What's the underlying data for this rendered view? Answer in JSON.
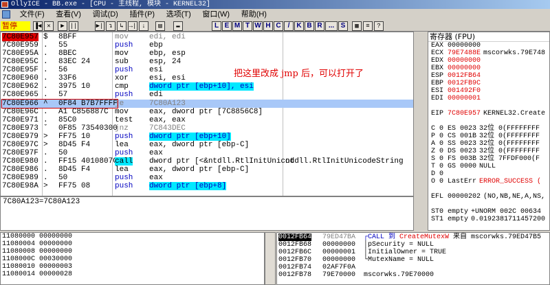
{
  "window": {
    "title": "OllyICE - BB.exe - [CPU - 主线程, 模块 - KERNEL32]"
  },
  "menu": [
    "文件(F)",
    "查看(V)",
    "调试(D)",
    "插件(P)",
    "选项(T)",
    "窗口(W)",
    "帮助(H)"
  ],
  "status": {
    "paused_label": "暂停"
  },
  "toolbar": {
    "buttons": [
      "▐◀",
      "✕",
      "▶",
      "||",
      "▶|",
      "↴",
      "↳",
      "→|",
      "↓",
      "▤",
      "▬"
    ],
    "letters": [
      "L",
      "E",
      "M",
      "T",
      "W",
      "H",
      "C",
      "/",
      "K",
      "B",
      "R",
      "...",
      "S"
    ]
  },
  "disasm": {
    "rows": [
      {
        "addr": "7C80E957",
        "mark": "$",
        "hex": "8BFF",
        "op": "mov",
        "args": "edi, edi",
        "comment": ""
      },
      {
        "addr": "7C80E959",
        "mark": ".",
        "hex": "55",
        "op": "push",
        "args": "ebp",
        "comment": ""
      },
      {
        "addr": "7C80E95A",
        "mark": ".",
        "hex": "8BEC",
        "op": "mov",
        "args": "ebp, esp",
        "comment": ""
      },
      {
        "addr": "7C80E95C",
        "mark": ".",
        "hex": "83EC 24",
        "op": "sub",
        "args": "esp, 24",
        "comment": ""
      },
      {
        "addr": "7C80E95F",
        "mark": ".",
        "hex": "56",
        "op": "push",
        "args": "esi",
        "comment": ""
      },
      {
        "addr": "7C80E960",
        "mark": ".",
        "hex": "33F6",
        "op": "xor",
        "args": "esi, esi",
        "comment": ""
      },
      {
        "addr": "7C80E962",
        "mark": ".",
        "hex": "3975 10",
        "op": "cmp",
        "args": "dword ptr [ebp+10], esi",
        "comment": ""
      },
      {
        "addr": "7C80E965",
        "mark": ".",
        "hex": "57",
        "op": "push",
        "args": "edi",
        "comment": ""
      },
      {
        "addr": "7C80E966",
        "mark": "^",
        "hex": "0F84 B7B7FFFF",
        "op": "je",
        "args": "7C80A123",
        "comment": ""
      },
      {
        "addr": "7C80E96C",
        "mark": ".",
        "hex": "A1 C856887C",
        "op": "mov",
        "args": "eax, dword ptr [7C8856C8]",
        "comment": ""
      },
      {
        "addr": "7C80E971",
        "mark": ".",
        "hex": "85C0",
        "op": "test",
        "args": "eax, eax",
        "comment": ""
      },
      {
        "addr": "7C80E973",
        "mark": "ˇ",
        "hex": "0F85 73540300",
        "op": "jnz",
        "args": "7C843DEC",
        "comment": ""
      },
      {
        "addr": "7C80E979",
        "mark": ">",
        "hex": "FF75 10",
        "op": "push",
        "args": "dword ptr [ebp+10]",
        "comment": ""
      },
      {
        "addr": "7C80E97C",
        "mark": ">",
        "hex": "8D45 F4",
        "op": "lea",
        "args": "eax, dword ptr [ebp-C]",
        "comment": ""
      },
      {
        "addr": "7C80E97F",
        "mark": ".",
        "hex": "50",
        "op": "push",
        "args": "eax",
        "comment": ""
      },
      {
        "addr": "7C80E980",
        "mark": ".",
        "hex": "FF15 4010807C",
        "op": "call",
        "args": "dword ptr [<&ntdll.RtlInitUnicod",
        "comment": "ntdll.RtlInitUnicodeString"
      },
      {
        "addr": "7C80E986",
        "mark": ".",
        "hex": "8D45 F4",
        "op": "lea",
        "args": "eax, dword ptr [ebp-C]",
        "comment": ""
      },
      {
        "addr": "7C80E989",
        "mark": ".",
        "hex": "50",
        "op": "push",
        "args": "eax",
        "comment": ""
      },
      {
        "addr": "7C80E98A",
        "mark": ">",
        "hex": "FF75 08",
        "op": "push",
        "args": "dword ptr [ebp+8]",
        "comment": ""
      }
    ],
    "annotation": "把这里改成 jmp 后，可以打开了"
  },
  "info": {
    "line": "7C80A123=7C80A123"
  },
  "registers": {
    "title": "寄存器 (FPU)",
    "rows": [
      {
        "name": "EAX",
        "value": "00000000",
        "extra": "",
        "red": false
      },
      {
        "name": "ECX",
        "value": "79E7488E",
        "extra": "mscorwks.79E748",
        "red": true
      },
      {
        "name": "EDX",
        "value": "00000000",
        "extra": "",
        "red": true
      },
      {
        "name": "EBX",
        "value": "00000000",
        "extra": "",
        "red": true
      },
      {
        "name": "ESP",
        "value": "0012FB64",
        "extra": "",
        "red": true
      },
      {
        "name": "EBP",
        "value": "0012FB9C",
        "extra": "",
        "red": true
      },
      {
        "name": "ESI",
        "value": "001492F0",
        "extra": "",
        "red": true
      },
      {
        "name": "EDI",
        "value": "00000001",
        "extra": "",
        "red": true
      },
      {
        "name": "",
        "value": "",
        "extra": "",
        "red": false
      },
      {
        "name": "EIP",
        "value": "7C80E957",
        "extra": "KERNEL32.Create",
        "red": true
      },
      {
        "name": "",
        "value": "",
        "extra": "",
        "red": false
      },
      {
        "name": "C 0",
        "value": "ES 0023",
        "extra": "32位 0(FFFFFFFF",
        "red": false
      },
      {
        "name": "P 0",
        "value": "CS 001B",
        "extra": "32位 0(FFFFFFFF",
        "red": false
      },
      {
        "name": "A 0",
        "value": "SS 0023",
        "extra": "32位 0(FFFFFFFF",
        "red": false
      },
      {
        "name": "Z 0",
        "value": "DS 0023",
        "extra": "32位 0(FFFFFFFF",
        "red": false
      },
      {
        "name": "S 0",
        "value": "FS 003B",
        "extra": "32位 7FFDF000(F",
        "red": false
      },
      {
        "name": "T 0",
        "value": "GS 0000",
        "extra": "NULL",
        "red": false
      },
      {
        "name": "D 0",
        "value": "",
        "extra": "",
        "red": false
      },
      {
        "name": "O 0",
        "value": "LastErr",
        "extra": "ERROR_SUCCESS (",
        "red": false
      },
      {
        "name": "",
        "value": "",
        "extra": "",
        "red": false
      },
      {
        "name": "EFL",
        "value": "00000202",
        "extra": "(NO,NB,NE,A,NS,",
        "red": false
      },
      {
        "name": "",
        "value": "",
        "extra": "",
        "red": false
      },
      {
        "name": "ST0",
        "value": "empty",
        "extra": "+UNORM 002C 00634",
        "red": false
      },
      {
        "name": "ST1",
        "value": "empty",
        "extra": "0.0192381711457200",
        "red": false
      }
    ]
  },
  "dump": {
    "rows": [
      {
        "addr": "11080000",
        "val": "00000000"
      },
      {
        "addr": "11080004",
        "val": "00000000"
      },
      {
        "addr": "11080008",
        "val": "00000000"
      },
      {
        "addr": "1108000C",
        "val": "00030000"
      },
      {
        "addr": "11080010",
        "val": "00000003"
      },
      {
        "addr": "11080014",
        "val": "00000028"
      }
    ]
  },
  "stack": {
    "rows": [
      {
        "addr": "0012FB64",
        "val": "79ED47BA",
        "pre": "┌CALL 到 ",
        "fn": "CreateMutexW",
        "post": " 来自 mscorwks.79ED47B5"
      },
      {
        "addr": "0012FB68",
        "val": "00000000",
        "pre": "│pSecurity = NULL",
        "fn": "",
        "post": ""
      },
      {
        "addr": "0012FB6C",
        "val": "00000001",
        "pre": "│InitialOwner = TRUE",
        "fn": "",
        "post": ""
      },
      {
        "addr": "0012FB70",
        "val": "00000000",
        "pre": "└MutexName = NULL",
        "fn": "",
        "post": ""
      },
      {
        "addr": "0012FB74",
        "val": "02AF7F0A",
        "pre": "",
        "fn": "",
        "post": ""
      },
      {
        "addr": "0012FB78",
        "val": "79E70000",
        "pre": "mscorwks.79E70000",
        "fn": "",
        "post": ""
      }
    ]
  }
}
